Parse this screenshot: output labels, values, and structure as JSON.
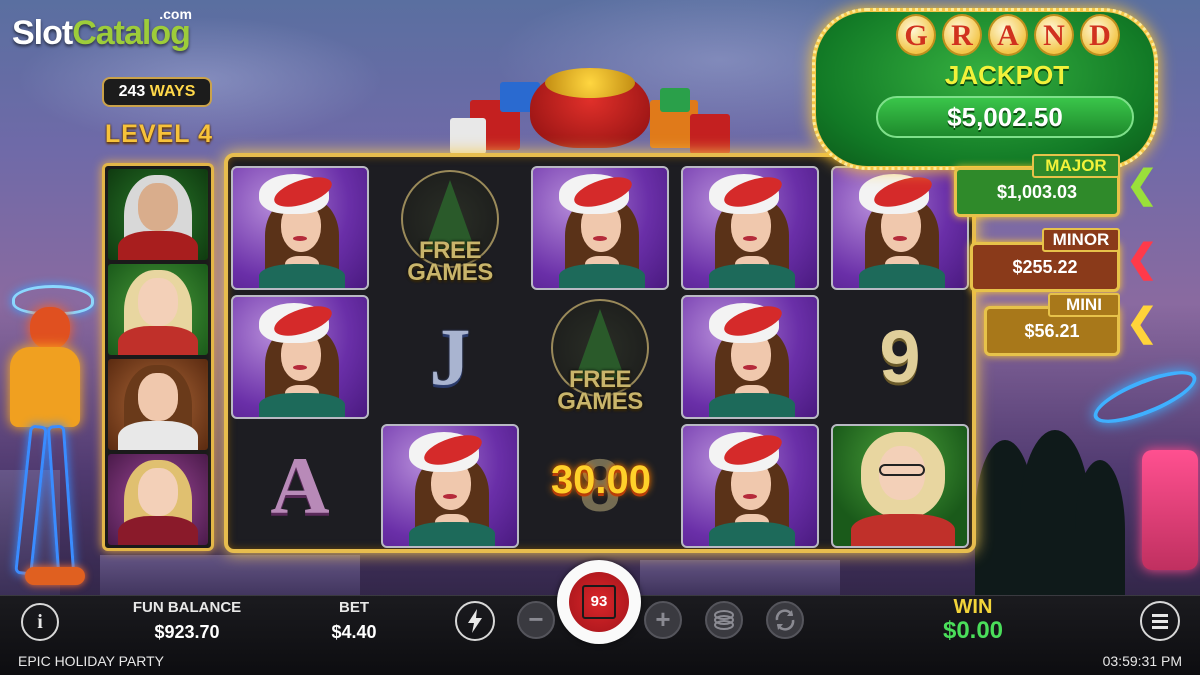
{
  "brand": {
    "slot": "Slot",
    "catalog": "Catalog",
    "dotcom": ".com"
  },
  "left_panel": {
    "ways_number": "243",
    "ways_word": "WAYS",
    "level": "LEVEL 4"
  },
  "reels": {
    "free_games_line1": "FREE",
    "free_games_line2": "GAMES",
    "letter_j": "J",
    "letter_a": "A",
    "number_9": "9",
    "number_8": "8",
    "win_amount": "30.00"
  },
  "jackpots": {
    "grand_letters": [
      "G",
      "R",
      "A",
      "N",
      "D"
    ],
    "grand_sub": "JACKPOT",
    "grand_value": "$5,002.50",
    "major_label": "MAJOR",
    "major_value": "$1,003.03",
    "minor_label": "MINOR",
    "minor_value": "$255.22",
    "mini_label": "MINI",
    "mini_value": "$56.21",
    "arrow_glyph": "❮",
    "colors": {
      "major": "#2f8a2a",
      "minor": "#8a3a1a",
      "mini": "#a8781a",
      "major_arrow": "#9ae03a",
      "minor_arrow": "#ff3a4a",
      "mini_arrow": "#ffd43a"
    }
  },
  "bottom_bar": {
    "info_icon": "i",
    "fun_balance_label": "FUN BALANCE",
    "fun_balance_value": "$923.70",
    "bet_label": "BET",
    "bet_value": "$4.40",
    "turbo_icon": "lightning-icon",
    "minus_glyph": "−",
    "plus_glyph": "+",
    "autoplay_count": "93",
    "coins_icon": "coins-icon",
    "autoplay_icon": "autoplay-icon",
    "win_label": "WIN",
    "win_value": "$0.00",
    "menu_icon": "menu-icon",
    "game_title": "EPIC HOLIDAY PARTY",
    "clock": "03:59:31 PM"
  }
}
